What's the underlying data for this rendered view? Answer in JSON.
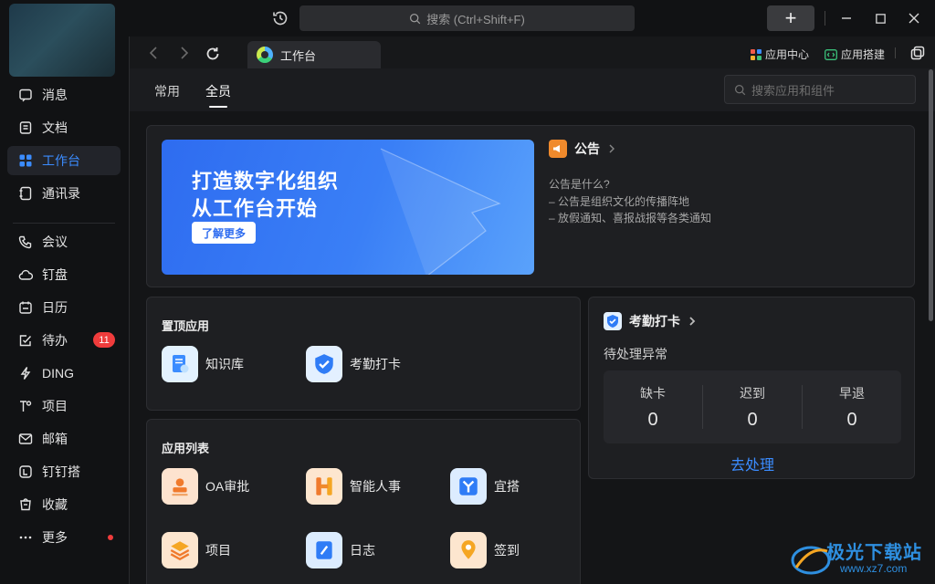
{
  "titlebar": {
    "search_placeholder": "搜索 (Ctrl+Shift+F)",
    "add_label": "+"
  },
  "sidebar": {
    "items": [
      {
        "label": "消息",
        "icon": "message-icon"
      },
      {
        "label": "文档",
        "icon": "document-icon"
      },
      {
        "label": "工作台",
        "icon": "workbench-icon",
        "active": true
      },
      {
        "label": "通讯录",
        "icon": "contacts-icon"
      },
      {
        "label": "会议",
        "icon": "meeting-icon"
      },
      {
        "label": "钉盘",
        "icon": "cloud-disk-icon"
      },
      {
        "label": "日历",
        "icon": "calendar-icon"
      },
      {
        "label": "待办",
        "icon": "todo-icon",
        "badge": "11"
      },
      {
        "label": "DING",
        "icon": "ding-icon"
      },
      {
        "label": "项目",
        "icon": "project-icon"
      },
      {
        "label": "邮箱",
        "icon": "mail-icon"
      },
      {
        "label": "钉钉搭",
        "icon": "builder-icon"
      },
      {
        "label": "收藏",
        "icon": "favorite-icon"
      },
      {
        "label": "更多",
        "icon": "more-icon"
      }
    ]
  },
  "tabbar": {
    "tab_title": "工作台",
    "app_center": "应用中心",
    "app_builder": "应用搭建"
  },
  "subbar": {
    "tabs": [
      "常用",
      "全员"
    ],
    "active_tab": "全员",
    "search_placeholder": "搜索应用和组件"
  },
  "banner": {
    "line1": "打造数字化组织",
    "line2": "从工作台开始",
    "button": "了解更多"
  },
  "notice": {
    "title": "公告",
    "lines": [
      "公告是什么?",
      "– 公告是组织文化的传播阵地",
      "– 放假通知、喜报战报等各类通知"
    ]
  },
  "pinned": {
    "title": "置顶应用",
    "apps": [
      "知识库",
      "考勤打卡"
    ]
  },
  "applist": {
    "title": "应用列表",
    "apps": [
      "OA审批",
      "智能人事",
      "宜搭",
      "项目",
      "日志",
      "签到"
    ]
  },
  "attendance": {
    "title": "考勤打卡",
    "subtitle": "待处理异常",
    "stats": [
      {
        "label": "缺卡",
        "value": "0"
      },
      {
        "label": "迟到",
        "value": "0"
      },
      {
        "label": "早退",
        "value": "0"
      }
    ],
    "action": "去处理"
  },
  "watermark": {
    "text": "极光下载站",
    "url": "www.xz7.com"
  },
  "colors": {
    "accent": "#3b8cff",
    "badge": "#f03c3c",
    "background": "#141517"
  }
}
